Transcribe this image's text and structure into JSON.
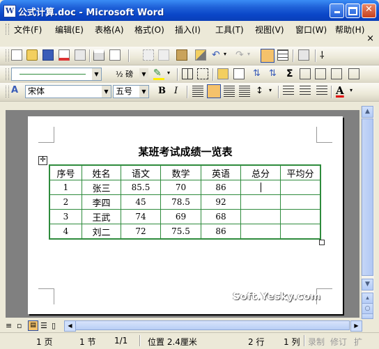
{
  "window": {
    "title": "公式计算.doc - Microsoft Word",
    "app_icon": "W"
  },
  "menu": {
    "items": [
      "文件(F)",
      "编辑(E)",
      "表格(A)",
      "格式(O)",
      "插入(I)",
      "工具(T)",
      "视图(V)",
      "窗口(W)",
      "帮助(H)"
    ],
    "close_doc": "×"
  },
  "formatting": {
    "style": "",
    "font_name": "宋体",
    "font_size": "五号",
    "font_size_small": "½ 磅",
    "bold": "B",
    "italic": "I",
    "font_color_letter": "A",
    "sigma": "Σ",
    "accent_colors": {
      "toolbar_active": "#f5c26b",
      "table_border": "#2e8b3c",
      "font_color_red": "#e00000",
      "highlight_yellow": "#ffee00"
    }
  },
  "document": {
    "heading": "某班考试成绩一览表",
    "table": {
      "headers": [
        "序号",
        "姓名",
        "语文",
        "数学",
        "英语",
        "总分",
        "平均分"
      ],
      "rows": [
        [
          "1",
          "张三",
          "85.5",
          "70",
          "86",
          "",
          ""
        ],
        [
          "2",
          "李四",
          "45",
          "78.5",
          "92",
          "",
          ""
        ],
        [
          "3",
          "王武",
          "74",
          "69",
          "68",
          "",
          ""
        ],
        [
          "4",
          "刘二",
          "72",
          "75.5",
          "86",
          "",
          ""
        ]
      ]
    },
    "watermark": "Soft.Yesky.com"
  },
  "status": {
    "page": "1 页",
    "section": "1 节",
    "page_of": "1/1",
    "position": "位置 2.4厘米",
    "line": "2 行",
    "column": "1 列",
    "rec": "录制",
    "trk": "修订",
    "ext": "扩"
  }
}
